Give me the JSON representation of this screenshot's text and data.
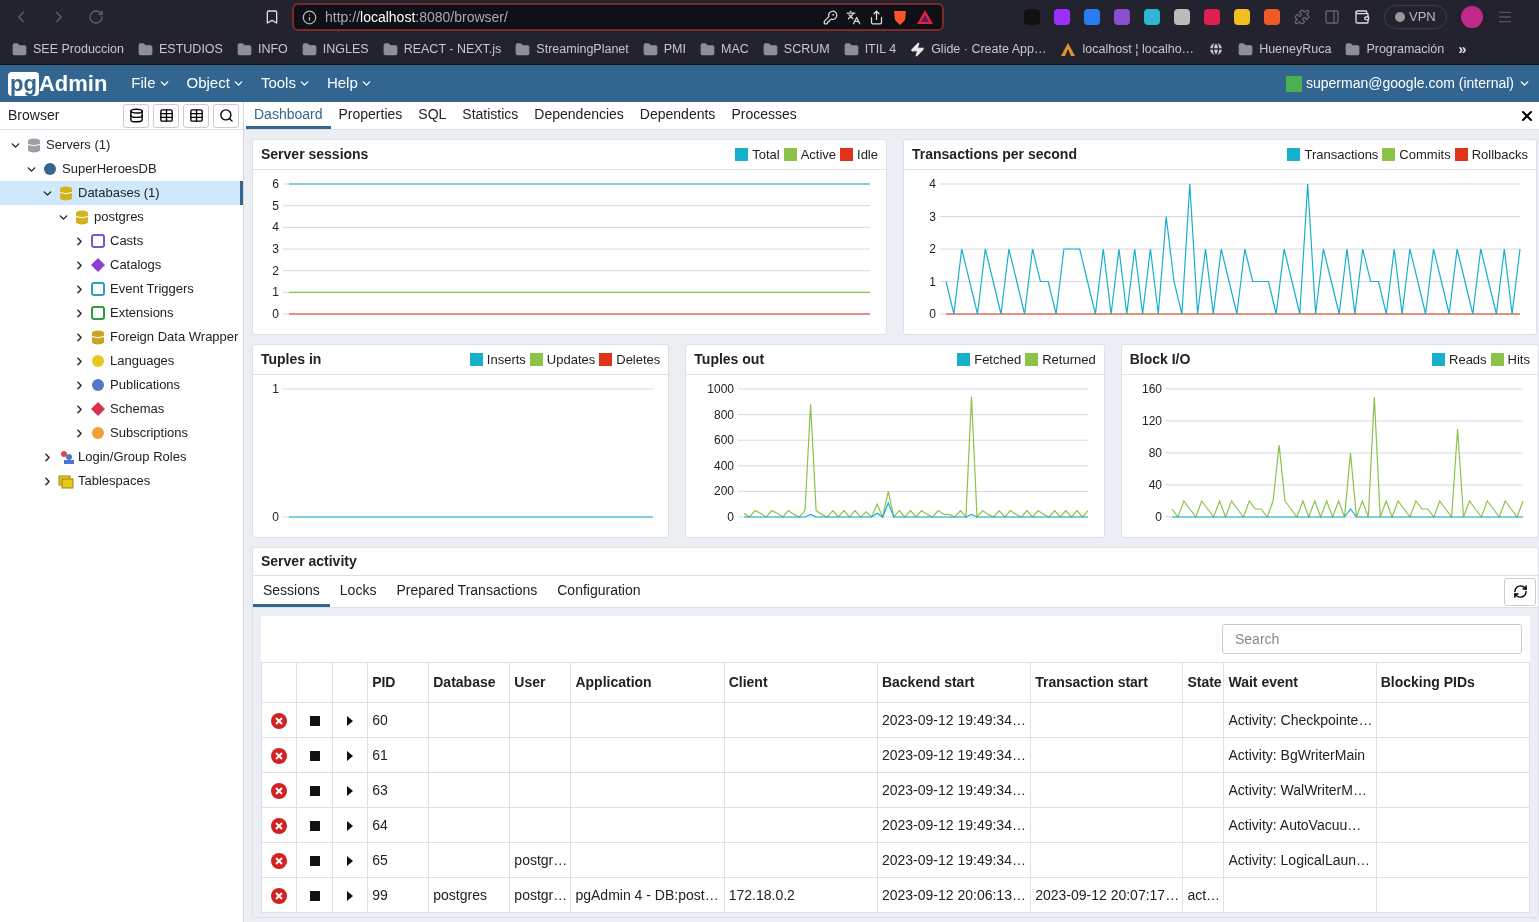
{
  "browser": {
    "url": {
      "scheme": "http://",
      "host": "localhost",
      "path": ":8080/browser/"
    },
    "vpn": "VPN",
    "bookmarks": [
      {
        "label": "SEE Produccion",
        "kind": "folder"
      },
      {
        "label": "ESTUDIOS",
        "kind": "folder"
      },
      {
        "label": "INFO",
        "kind": "folder"
      },
      {
        "label": "INGLES",
        "kind": "folder"
      },
      {
        "label": "REACT - NEXT.js",
        "kind": "folder"
      },
      {
        "label": "StreamingPlanet",
        "kind": "folder"
      },
      {
        "label": "PMI",
        "kind": "folder"
      },
      {
        "label": "MAC",
        "kind": "folder"
      },
      {
        "label": "SCRUM",
        "kind": "folder"
      },
      {
        "label": "ITIL 4",
        "kind": "folder"
      },
      {
        "label": "Glide · Create App…",
        "kind": "bolt"
      },
      {
        "label": "localhost ¦ localho…",
        "kind": "site"
      },
      {
        "kind": "globe"
      },
      {
        "label": "HueneyRuca",
        "kind": "folder"
      },
      {
        "label": "Programación",
        "kind": "folder"
      }
    ],
    "more": "»"
  },
  "app": {
    "logo": {
      "badge": "pg",
      "text": "Admin"
    },
    "menus": [
      "File",
      "Object",
      "Tools",
      "Help"
    ],
    "user": "superman@google.com (internal)"
  },
  "sidebar": {
    "title": "Browser",
    "tree": [
      {
        "label": "Servers (1)",
        "kind": "servers",
        "expanded": true,
        "selected": false,
        "children": [
          {
            "label": "SuperHeroesDB",
            "kind": "server",
            "expanded": true,
            "selected": false,
            "children": [
              {
                "label": "Databases (1)",
                "kind": "databases",
                "expanded": true,
                "selected": true,
                "children": [
                  {
                    "label": "postgres",
                    "kind": "database",
                    "expanded": true,
                    "selected": false,
                    "children": [
                      {
                        "label": "Casts",
                        "kind": "casts",
                        "expanded": false,
                        "selected": false
                      },
                      {
                        "label": "Catalogs",
                        "kind": "catalogs",
                        "expanded": false,
                        "selected": false
                      },
                      {
                        "label": "Event Triggers",
                        "kind": "triggers",
                        "expanded": false,
                        "selected": false
                      },
                      {
                        "label": "Extensions",
                        "kind": "extensions",
                        "expanded": false,
                        "selected": false
                      },
                      {
                        "label": "Foreign Data Wrapper",
                        "kind": "wrappers",
                        "expanded": false,
                        "selected": false
                      },
                      {
                        "label": "Languages",
                        "kind": "languages",
                        "expanded": false,
                        "selected": false
                      },
                      {
                        "label": "Publications",
                        "kind": "publications",
                        "expanded": false,
                        "selected": false
                      },
                      {
                        "label": "Schemas",
                        "kind": "schemas",
                        "expanded": false,
                        "selected": false
                      },
                      {
                        "label": "Subscriptions",
                        "kind": "subscriptions",
                        "expanded": false,
                        "selected": false
                      }
                    ]
                  }
                ]
              },
              {
                "label": "Login/Group Roles",
                "kind": "roles",
                "expanded": false,
                "selected": false
              },
              {
                "label": "Tablespaces",
                "kind": "tablespaces",
                "expanded": false,
                "selected": false
              }
            ]
          }
        ]
      }
    ]
  },
  "tabs": [
    {
      "label": "Dashboard",
      "selected": true
    },
    {
      "label": "Properties",
      "selected": false
    },
    {
      "label": "SQL",
      "selected": false
    },
    {
      "label": "Statistics",
      "selected": false
    },
    {
      "label": "Dependencies",
      "selected": false
    },
    {
      "label": "Dependents",
      "selected": false
    },
    {
      "label": "Processes",
      "selected": false
    }
  ],
  "charts": [
    {
      "chart_data": {
        "type": "line",
        "grid": true,
        "title": "Server sessions",
        "ylim": [
          0,
          6
        ],
        "yticks": [
          0,
          1,
          2,
          3,
          4,
          5,
          6
        ],
        "series": [
          {
            "name": "Total",
            "color": "#17b0cc",
            "values": [
              6,
              6,
              6,
              6,
              6,
              6,
              6,
              6,
              6,
              6,
              6,
              6,
              6,
              6,
              6,
              6,
              6,
              6,
              6,
              6
            ]
          },
          {
            "name": "Active",
            "color": "#8bc34a",
            "values": [
              1,
              1,
              1,
              1,
              1,
              1,
              1,
              1,
              1,
              1,
              1,
              1,
              1,
              1,
              1,
              1,
              1,
              1,
              1,
              1
            ]
          },
          {
            "name": "Idle",
            "color": "#e0331a",
            "values": [
              0,
              0,
              0,
              0,
              0,
              0,
              0,
              0,
              0,
              0,
              0,
              0,
              0,
              0,
              0,
              0,
              0,
              0,
              0,
              0
            ]
          }
        ]
      }
    },
    {
      "chart_data": {
        "type": "line",
        "grid": true,
        "title": "Transactions per second",
        "ylim": [
          0,
          4
        ],
        "yticks": [
          0,
          1,
          2,
          3,
          4
        ],
        "series": [
          {
            "name": "Transactions",
            "color": "#17b0cc",
            "values": [
              1,
              0,
              2,
              1,
              0,
              2,
              1,
              0,
              2,
              1,
              0,
              2,
              1,
              1,
              0,
              2,
              2,
              2,
              1,
              0,
              2,
              0,
              2,
              0,
              2,
              0,
              2,
              0,
              3,
              1,
              0,
              4,
              0,
              2,
              0,
              2,
              1,
              0,
              2,
              1,
              1,
              1,
              0,
              2,
              1,
              0,
              4,
              0,
              2,
              1,
              0,
              2,
              0,
              2,
              1,
              1,
              0,
              2,
              0,
              2,
              1,
              0,
              2,
              1,
              0,
              2,
              1,
              0,
              2,
              1,
              0,
              2,
              0,
              2
            ]
          },
          {
            "name": "Commits",
            "color": "#8bc34a",
            "values": [
              null,
              null,
              null,
              null,
              null,
              null,
              null,
              null,
              null,
              null,
              null,
              null,
              null,
              null,
              null,
              null,
              null,
              null,
              null,
              null
            ]
          },
          {
            "name": "Rollbacks",
            "color": "#e0331a",
            "values": [
              0,
              0,
              0,
              0,
              0,
              0,
              0,
              0,
              0,
              0,
              0,
              0,
              0,
              0,
              0,
              0,
              0,
              0,
              0,
              0,
              0,
              0,
              0,
              0,
              0,
              0,
              0,
              0,
              0,
              0,
              0,
              0,
              0,
              0,
              0,
              0,
              0,
              0,
              0,
              0,
              0,
              0,
              0,
              0,
              0,
              0,
              0,
              0,
              0,
              0,
              0,
              0,
              0,
              0,
              0,
              0,
              0,
              0,
              0,
              0,
              0,
              0,
              0,
              0,
              0,
              0,
              0,
              0,
              0,
              0,
              0,
              0,
              0,
              0
            ]
          }
        ]
      }
    },
    {
      "chart_data": {
        "type": "line",
        "grid": true,
        "title": "Tuples in",
        "ylim": [
          0,
          1
        ],
        "yticks": [
          0,
          1
        ],
        "series": [
          {
            "name": "Inserts",
            "color": "#17b0cc",
            "values": [
              0,
              0,
              0,
              0,
              0,
              0,
              0,
              0,
              0,
              0,
              0,
              0,
              0,
              0,
              0,
              0,
              0,
              0,
              0,
              0
            ]
          },
          {
            "name": "Updates",
            "color": "#8bc34a",
            "values": [
              null,
              null,
              null,
              null,
              null,
              null,
              null,
              null,
              null,
              null,
              null,
              null,
              null,
              null,
              null,
              null,
              null,
              null,
              null,
              null
            ]
          },
          {
            "name": "Deletes",
            "color": "#e0331a",
            "values": [
              null,
              null,
              null,
              null,
              null,
              null,
              null,
              null,
              null,
              null,
              null,
              null,
              null,
              null,
              null,
              null,
              null,
              null,
              null,
              null
            ]
          }
        ]
      }
    },
    {
      "chart_data": {
        "type": "line",
        "grid": true,
        "title": "Tuples out",
        "ylim": [
          0,
          1000
        ],
        "yticks": [
          0,
          200,
          400,
          600,
          800,
          1000
        ],
        "series": [
          {
            "name": "Fetched",
            "color": "#17b0cc",
            "values": [
              0,
              0,
              0,
              0,
              0,
              0,
              0,
              0,
              0,
              0,
              0,
              0,
              20,
              0,
              0,
              0,
              0,
              0,
              0,
              0,
              0,
              0,
              0,
              0,
              30,
              0,
              110,
              0,
              0,
              0,
              0,
              0,
              0,
              0,
              0,
              0,
              0,
              0,
              0,
              0,
              0,
              20,
              0,
              0,
              0,
              0,
              0,
              0,
              0,
              0,
              0,
              0,
              0,
              0,
              0,
              0,
              0,
              0,
              0,
              0,
              0,
              0,
              0
            ]
          },
          {
            "name": "Returned",
            "color": "#8bc34a",
            "values": [
              30,
              0,
              50,
              30,
              0,
              50,
              30,
              0,
              50,
              20,
              0,
              50,
              880,
              50,
              20,
              0,
              50,
              0,
              50,
              0,
              50,
              0,
              40,
              0,
              100,
              0,
              200,
              0,
              50,
              0,
              50,
              0,
              50,
              20,
              0,
              50,
              20,
              20,
              0,
              50,
              0,
              940,
              0,
              50,
              20,
              0,
              50,
              0,
              50,
              20,
              0,
              50,
              0,
              50,
              20,
              0,
              50,
              0,
              50,
              0,
              50,
              0,
              50
            ]
          }
        ]
      }
    },
    {
      "chart_data": {
        "type": "line",
        "grid": true,
        "title": "Block I/O",
        "ylim": [
          0,
          160
        ],
        "yticks": [
          0,
          40,
          80,
          120,
          160
        ],
        "series": [
          {
            "name": "Reads",
            "color": "#17b0cc",
            "values": [
              0,
              0,
              0,
              0,
              0,
              0,
              0,
              0,
              0,
              0,
              0,
              0,
              0,
              0,
              0,
              0,
              0,
              0,
              0,
              0,
              0,
              0,
              0,
              0,
              0,
              0,
              0,
              0,
              0,
              0,
              10,
              0,
              0,
              0,
              0,
              0,
              0,
              0,
              0,
              0,
              0,
              0,
              0,
              0,
              0,
              0,
              0,
              0,
              0,
              0,
              0,
              0,
              0,
              0,
              0,
              0,
              0,
              0,
              0,
              0
            ]
          },
          {
            "name": "Hits",
            "color": "#8bc34a",
            "values": [
              10,
              0,
              20,
              10,
              0,
              20,
              10,
              0,
              20,
              0,
              20,
              10,
              0,
              20,
              10,
              10,
              0,
              20,
              90,
              20,
              10,
              0,
              20,
              0,
              20,
              0,
              20,
              0,
              20,
              0,
              80,
              0,
              20,
              0,
              150,
              0,
              20,
              0,
              20,
              10,
              0,
              20,
              10,
              10,
              0,
              20,
              10,
              0,
              110,
              0,
              20,
              10,
              0,
              20,
              10,
              0,
              20,
              10,
              0,
              20
            ]
          }
        ]
      }
    }
  ],
  "server_activity": {
    "title": "Server activity",
    "tabs": [
      {
        "label": "Sessions",
        "selected": true
      },
      {
        "label": "Locks",
        "selected": false
      },
      {
        "label": "Prepared Transactions",
        "selected": false
      },
      {
        "label": "Configuration",
        "selected": false
      }
    ],
    "search": {
      "placeholder": "Search"
    },
    "columns": [
      "PID",
      "Database",
      "User",
      "Application",
      "Client",
      "Backend start",
      "Transaction start",
      "State",
      "Wait event",
      "Blocking PIDs"
    ],
    "rows": [
      {
        "cells": [
          "60",
          null,
          null,
          null,
          null,
          "2023-09-12 19:49:34…",
          null,
          null,
          "Activity: Checkpointe…",
          null
        ]
      },
      {
        "cells": [
          "61",
          null,
          null,
          null,
          null,
          "2023-09-12 19:49:34…",
          null,
          null,
          "Activity: BgWriterMain",
          null
        ]
      },
      {
        "cells": [
          "63",
          null,
          null,
          null,
          null,
          "2023-09-12 19:49:34…",
          null,
          null,
          "Activity: WalWriterM…",
          null
        ]
      },
      {
        "cells": [
          "64",
          null,
          null,
          null,
          null,
          "2023-09-12 19:49:34…",
          null,
          null,
          "Activity: AutoVacuu…",
          null
        ]
      },
      {
        "cells": [
          "65",
          null,
          "postgr…",
          null,
          null,
          "2023-09-12 19:49:34…",
          null,
          null,
          "Activity: LogicalLaun…",
          null
        ]
      },
      {
        "cells": [
          "99",
          "postgres",
          "postgr…",
          "pgAdmin 4 - DB:post…",
          "172.18.0.2",
          "2023-09-12 20:06:13…",
          "2023-09-12 20:07:17…",
          "act…",
          null,
          null
        ]
      }
    ]
  }
}
